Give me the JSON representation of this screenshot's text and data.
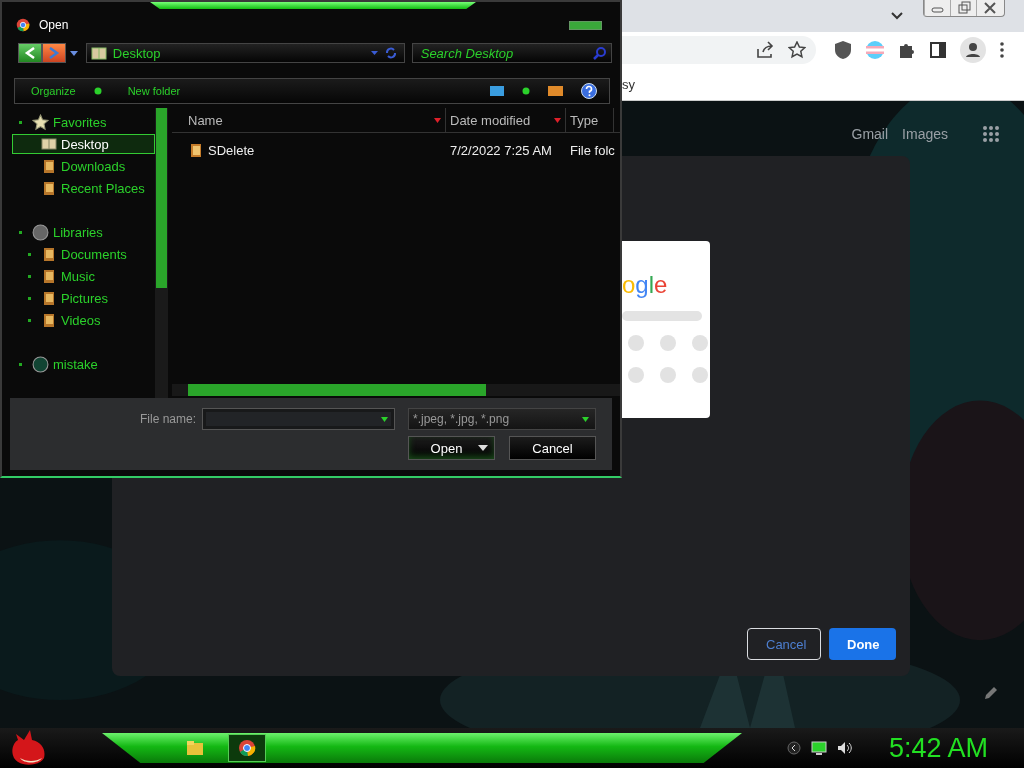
{
  "browser": {
    "bookmark": "sy",
    "header_links": [
      "Gmail",
      "Images"
    ]
  },
  "dialog": {
    "logo_text": "ogle",
    "buttons": [
      {
        "label": "Cancel",
        "kind": "secondary"
      },
      {
        "label": "Done",
        "kind": "primary"
      }
    ]
  },
  "open_dialog": {
    "title": "Open",
    "address": "Desktop",
    "search": {
      "placeholder": "Search Desktop"
    },
    "toolbar": [
      {
        "label": "Organize",
        "dropdown": true
      },
      {
        "label": "New folder",
        "dropdown": false
      }
    ],
    "nav": [
      {
        "label": "Favorites",
        "kind": "star",
        "selected": false,
        "children": [
          {
            "label": "Desktop",
            "kind": "book",
            "selected": true
          },
          {
            "label": "Downloads",
            "kind": "folder",
            "selected": false
          },
          {
            "label": "Recent Places",
            "kind": "folder",
            "selected": false
          }
        ]
      },
      {
        "label": "Libraries",
        "kind": "disc",
        "selected": false,
        "children": [
          {
            "label": "Documents",
            "kind": "folder",
            "selected": false
          },
          {
            "label": "Music",
            "kind": "folder",
            "selected": false
          },
          {
            "label": "Pictures",
            "kind": "folder",
            "selected": false
          },
          {
            "label": "Videos",
            "kind": "folder",
            "selected": false
          }
        ]
      },
      {
        "label": "mistake",
        "kind": "disc",
        "selected": false
      }
    ],
    "columns": [
      "Name",
      "Date modified",
      "Type"
    ],
    "rows": [
      {
        "name": "SDelete",
        "date_modified": "7/2/2022 7:25 AM",
        "type": "File folc"
      }
    ],
    "file_name": {
      "label": "File name:"
    },
    "filter": "*.jpeg, *.jpg, *.png",
    "buttons": [
      {
        "label": "Open",
        "kind": "split"
      },
      {
        "label": "Cancel",
        "kind": "plain"
      }
    ]
  },
  "taskbar": {
    "tasks": [
      {
        "kind": "folder",
        "selected": false
      },
      {
        "kind": "browser",
        "selected": true
      }
    ],
    "clock": "5:42 AM"
  }
}
